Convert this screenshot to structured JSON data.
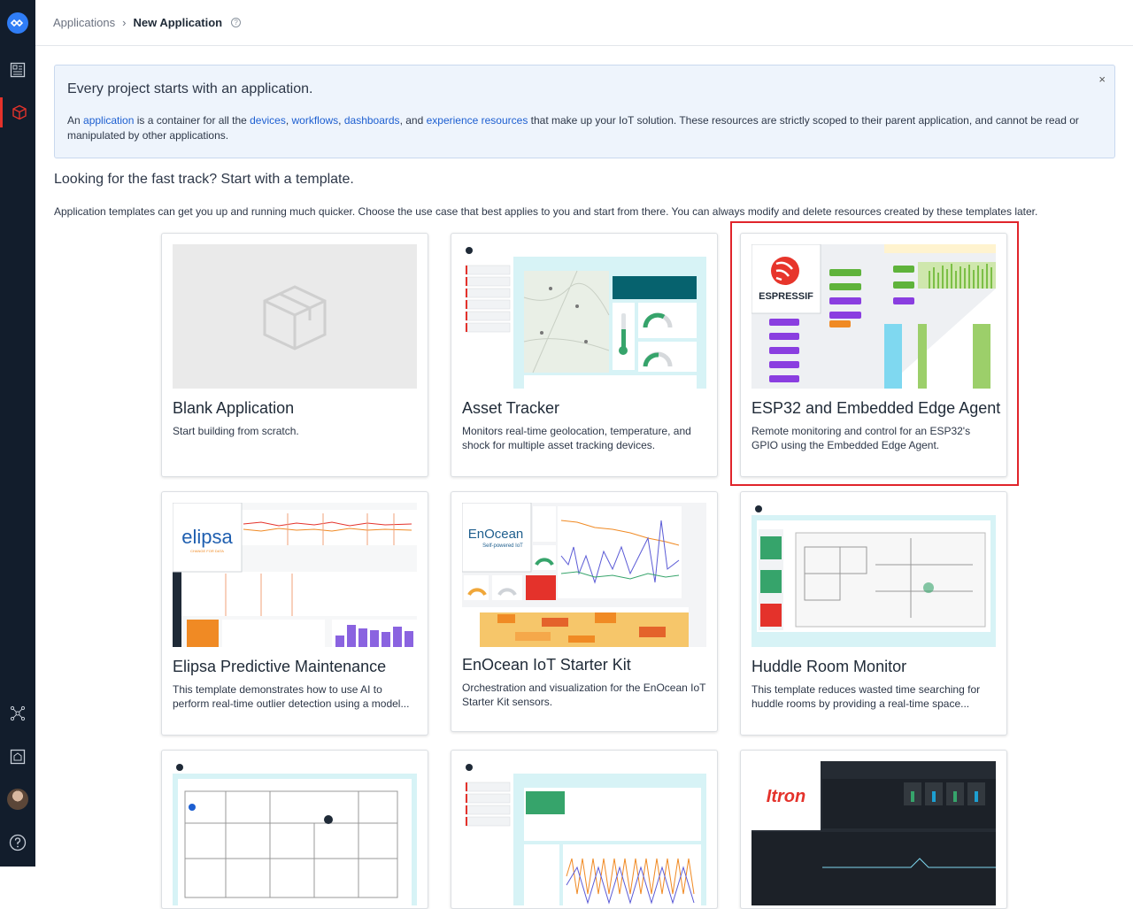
{
  "breadcrumb": {
    "parent": "Applications",
    "separator": "›",
    "current": "New Application"
  },
  "alert": {
    "title": "Every project starts with an application.",
    "body_prefix": "An ",
    "link_application": "application",
    "body_part2": " is a container for all the ",
    "link_devices": "devices",
    "comma1": ", ",
    "link_workflows": "workflows",
    "comma2": ", ",
    "link_dashboards": "dashboards",
    "and": ", and ",
    "link_experience": "experience resources",
    "body_suffix": " that make up your IoT solution. These resources are strictly scoped to their parent application, and cannot be read or manipulated by other applications.",
    "close": "×"
  },
  "templates_section": {
    "title": "Looking for the fast track? Start with a template.",
    "description": "Application templates can get you up and running much quicker. Choose the use case that best applies to you and start from there. You can always modify and delete resources created by these templates later."
  },
  "cards": [
    {
      "title": "Blank Application",
      "description": "Start building from scratch."
    },
    {
      "title": "Asset Tracker",
      "description": "Monitors real-time geolocation, temperature, and shock for multiple asset tracking devices."
    },
    {
      "title": "ESP32 and Embedded Edge Agent",
      "description": "Remote monitoring and control for an ESP32's GPIO using the Embedded Edge Agent.",
      "logo": "ESPRESSIF"
    },
    {
      "title": "Elipsa Predictive Maintenance",
      "description": "This template demonstrates how to use AI to perform real-time outlier detection using a model...",
      "logo": "elipsa",
      "logo_sub": "CHANGE FOR DATA"
    },
    {
      "title": "EnOcean IoT Starter Kit",
      "description": "Orchestration and visualization for the EnOcean IoT Starter Kit sensors.",
      "logo": "EnOcean",
      "logo_sub": "Self-powered IoT"
    },
    {
      "title": "Huddle Room Monitor",
      "description": "This template reduces wasted time searching for huddle rooms by providing a real-time space..."
    },
    {
      "title": "",
      "description": ""
    },
    {
      "title": "",
      "description": ""
    },
    {
      "title": "",
      "description": "",
      "logo": "Itron"
    }
  ],
  "colors": {
    "sidebar": "#121d2c",
    "accent_red": "#e0242b",
    "link": "#1d5fd1",
    "alert_bg": "#eef4fc"
  }
}
